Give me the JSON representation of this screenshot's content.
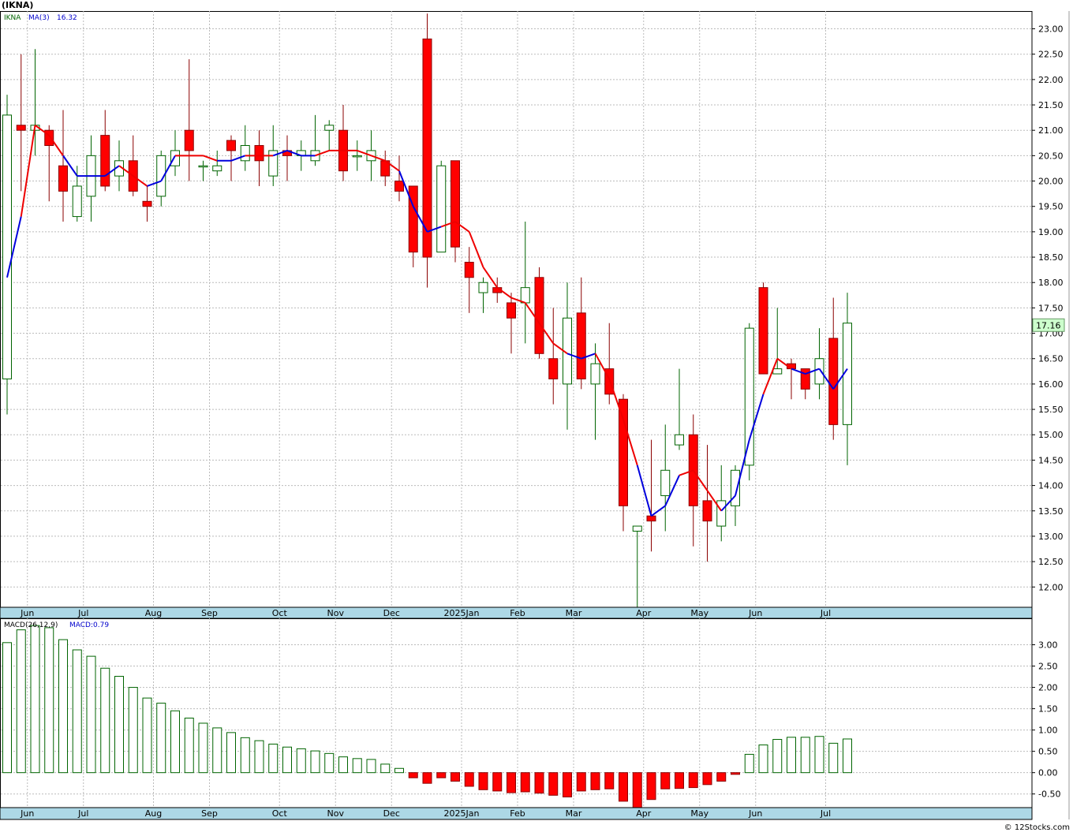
{
  "header": {
    "title": "(IKNA)"
  },
  "footer": {
    "credit": "© 12Stocks.com"
  },
  "colors": {
    "up_body": "#ffffff",
    "up_border": "#006400",
    "down_body": "#ff0000",
    "down_border": "#8b0000",
    "ma_up": "#0000dd",
    "ma_down": "#ee0000",
    "grid": "#bbbbbb",
    "axis_bar": "#add8e6",
    "macd_pos": "#006400",
    "macd_neg": "#ff0000",
    "last_price_bg": "#ccffcc"
  },
  "chart_data": [
    {
      "type": "candlestick",
      "legend": {
        "symbol": "IKNA",
        "ma_label": "MA(3)",
        "ma_value": "16.32"
      },
      "last_price_label": "17.16",
      "ylim": [
        11.6,
        23.35
      ],
      "y_ticks": [
        "12.00",
        "12.50",
        "13.00",
        "13.50",
        "14.00",
        "14.50",
        "15.00",
        "15.50",
        "16.00",
        "16.50",
        "17.00",
        "17.50",
        "18.00",
        "18.50",
        "19.00",
        "19.50",
        "20.00",
        "20.50",
        "21.00",
        "21.50",
        "22.00",
        "22.50",
        "23.00"
      ],
      "x_labels": [
        {
          "label": "Jun",
          "week": 1
        },
        {
          "label": "Jul",
          "week": 5
        },
        {
          "label": "Aug",
          "week": 10
        },
        {
          "label": "Sep",
          "week": 14
        },
        {
          "label": "Oct",
          "week": 19
        },
        {
          "label": "Nov",
          "week": 23
        },
        {
          "label": "Dec",
          "week": 27
        },
        {
          "label": "2025Jan",
          "week": 32
        },
        {
          "label": "Feb",
          "week": 36
        },
        {
          "label": "Mar",
          "week": 40
        },
        {
          "label": "Apr",
          "week": 45
        },
        {
          "label": "May",
          "week": 49
        },
        {
          "label": "Jun",
          "week": 53
        },
        {
          "label": "Jul",
          "week": 58
        }
      ],
      "candles": [
        {
          "o": 16.1,
          "h": 21.7,
          "l": 15.4,
          "c": 21.3
        },
        {
          "o": 21.1,
          "h": 22.5,
          "l": 19.8,
          "c": 21.0
        },
        {
          "o": 21.0,
          "h": 22.6,
          "l": 20.5,
          "c": 21.1
        },
        {
          "o": 21.0,
          "h": 21.1,
          "l": 19.6,
          "c": 20.7
        },
        {
          "o": 20.3,
          "h": 21.4,
          "l": 19.2,
          "c": 19.8
        },
        {
          "o": 19.3,
          "h": 20.3,
          "l": 19.2,
          "c": 19.9
        },
        {
          "o": 19.7,
          "h": 20.9,
          "l": 19.2,
          "c": 20.5
        },
        {
          "o": 20.9,
          "h": 21.4,
          "l": 19.8,
          "c": 19.9
        },
        {
          "o": 20.1,
          "h": 20.8,
          "l": 19.8,
          "c": 20.4
        },
        {
          "o": 20.4,
          "h": 20.9,
          "l": 19.7,
          "c": 19.8
        },
        {
          "o": 19.6,
          "h": 19.9,
          "l": 19.2,
          "c": 19.5
        },
        {
          "o": 19.7,
          "h": 20.6,
          "l": 19.5,
          "c": 20.5
        },
        {
          "o": 20.3,
          "h": 21.0,
          "l": 20.1,
          "c": 20.6
        },
        {
          "o": 21.0,
          "h": 22.4,
          "l": 20.0,
          "c": 20.6
        },
        {
          "o": 20.3,
          "h": 20.4,
          "l": 20.0,
          "c": 20.3
        },
        {
          "o": 20.2,
          "h": 20.6,
          "l": 20.1,
          "c": 20.3
        },
        {
          "o": 20.8,
          "h": 20.9,
          "l": 20.0,
          "c": 20.6
        },
        {
          "o": 20.4,
          "h": 21.1,
          "l": 20.2,
          "c": 20.7
        },
        {
          "o": 20.7,
          "h": 21.0,
          "l": 19.9,
          "c": 20.4
        },
        {
          "o": 20.1,
          "h": 21.1,
          "l": 19.9,
          "c": 20.6
        },
        {
          "o": 20.6,
          "h": 20.9,
          "l": 20.0,
          "c": 20.5
        },
        {
          "o": 20.5,
          "h": 20.8,
          "l": 20.2,
          "c": 20.6
        },
        {
          "o": 20.4,
          "h": 21.3,
          "l": 20.3,
          "c": 20.6
        },
        {
          "o": 21.0,
          "h": 21.2,
          "l": 20.6,
          "c": 21.1
        },
        {
          "o": 21.0,
          "h": 21.5,
          "l": 20.0,
          "c": 20.2
        },
        {
          "o": 20.5,
          "h": 20.8,
          "l": 20.2,
          "c": 20.5
        },
        {
          "o": 20.4,
          "h": 21.0,
          "l": 20.0,
          "c": 20.6
        },
        {
          "o": 20.4,
          "h": 20.6,
          "l": 19.9,
          "c": 20.1
        },
        {
          "o": 20.0,
          "h": 20.5,
          "l": 19.6,
          "c": 19.8
        },
        {
          "o": 19.9,
          "h": 19.9,
          "l": 18.3,
          "c": 18.6
        },
        {
          "o": 22.8,
          "h": 23.3,
          "l": 17.9,
          "c": 18.5
        },
        {
          "o": 18.6,
          "h": 20.4,
          "l": 18.6,
          "c": 20.3
        },
        {
          "o": 20.4,
          "h": 20.4,
          "l": 18.4,
          "c": 18.7
        },
        {
          "o": 18.4,
          "h": 18.7,
          "l": 17.4,
          "c": 18.1
        },
        {
          "o": 17.8,
          "h": 18.1,
          "l": 17.4,
          "c": 18.0
        },
        {
          "o": 17.9,
          "h": 18.1,
          "l": 17.6,
          "c": 17.8
        },
        {
          "o": 17.6,
          "h": 17.8,
          "l": 16.6,
          "c": 17.3
        },
        {
          "o": 17.6,
          "h": 19.2,
          "l": 16.8,
          "c": 17.9
        },
        {
          "o": 18.1,
          "h": 18.3,
          "l": 16.5,
          "c": 16.6
        },
        {
          "o": 16.5,
          "h": 17.5,
          "l": 15.6,
          "c": 16.1
        },
        {
          "o": 16.0,
          "h": 18.0,
          "l": 15.1,
          "c": 17.3
        },
        {
          "o": 17.4,
          "h": 18.1,
          "l": 15.9,
          "c": 16.1
        },
        {
          "o": 16.0,
          "h": 16.8,
          "l": 14.9,
          "c": 16.4
        },
        {
          "o": 16.3,
          "h": 17.2,
          "l": 15.6,
          "c": 15.8
        },
        {
          "o": 15.7,
          "h": 15.8,
          "l": 13.1,
          "c": 13.6
        },
        {
          "o": 13.1,
          "h": 13.2,
          "l": 11.6,
          "c": 13.2
        },
        {
          "o": 13.4,
          "h": 14.9,
          "l": 12.7,
          "c": 13.3
        },
        {
          "o": 13.8,
          "h": 15.2,
          "l": 13.1,
          "c": 14.3
        },
        {
          "o": 14.8,
          "h": 16.3,
          "l": 14.7,
          "c": 15.0
        },
        {
          "o": 15.0,
          "h": 15.4,
          "l": 12.8,
          "c": 13.6
        },
        {
          "o": 13.7,
          "h": 14.8,
          "l": 12.5,
          "c": 13.3
        },
        {
          "o": 13.2,
          "h": 14.4,
          "l": 12.9,
          "c": 13.7
        },
        {
          "o": 13.6,
          "h": 14.4,
          "l": 13.2,
          "c": 14.3
        },
        {
          "o": 14.4,
          "h": 17.2,
          "l": 14.1,
          "c": 17.1
        },
        {
          "o": 17.9,
          "h": 18.0,
          "l": 16.2,
          "c": 16.2
        },
        {
          "o": 16.2,
          "h": 17.5,
          "l": 16.2,
          "c": 16.3
        },
        {
          "o": 16.4,
          "h": 16.5,
          "l": 15.7,
          "c": 16.3
        },
        {
          "o": 16.3,
          "h": 16.3,
          "l": 15.7,
          "c": 15.9
        },
        {
          "o": 16.0,
          "h": 17.1,
          "l": 15.7,
          "c": 16.5
        },
        {
          "o": 16.9,
          "h": 17.7,
          "l": 14.9,
          "c": 15.2
        },
        {
          "o": 15.2,
          "h": 17.8,
          "l": 14.4,
          "c": 17.2
        }
      ],
      "ma3": [
        18.1,
        19.3,
        21.1,
        20.9,
        20.5,
        20.1,
        20.1,
        20.1,
        20.3,
        20.1,
        19.9,
        20.0,
        20.5,
        20.5,
        20.5,
        20.4,
        20.4,
        20.5,
        20.5,
        20.5,
        20.6,
        20.5,
        20.5,
        20.6,
        20.6,
        20.6,
        20.5,
        20.4,
        20.2,
        19.5,
        19.0,
        19.1,
        19.2,
        19.0,
        18.3,
        17.9,
        17.7,
        17.6,
        17.2,
        16.8,
        16.6,
        16.5,
        16.6,
        16.1,
        15.3,
        14.4,
        13.4,
        13.6,
        14.2,
        14.3,
        13.9,
        13.5,
        13.8,
        14.9,
        15.8,
        16.5,
        16.3,
        16.2,
        16.3,
        15.9,
        16.3
      ],
      "ma_color": [
        "u",
        "u",
        "d",
        "d",
        "d",
        "u",
        "u",
        "u",
        "u",
        "d",
        "d",
        "u",
        "u",
        "d",
        "d",
        "d",
        "u",
        "u",
        "d",
        "d",
        "u",
        "u",
        "u",
        "d",
        "d",
        "d",
        "d",
        "d",
        "d",
        "u",
        "u",
        "u",
        "d",
        "d",
        "d",
        "d",
        "d",
        "d",
        "d",
        "d",
        "d",
        "u",
        "u",
        "d",
        "d",
        "d",
        "u",
        "u",
        "u",
        "d",
        "d",
        "d",
        "u",
        "u",
        "u",
        "d",
        "d",
        "u",
        "u",
        "u",
        "u"
      ]
    },
    {
      "type": "bar",
      "legend": {
        "label": "MACD(26,12,9)",
        "value": "MACD:0.79"
      },
      "ylim": [
        -0.82,
        3.62
      ],
      "y_ticks": [
        "-0.50",
        "0.00",
        "0.50",
        "1.00",
        "1.50",
        "2.00",
        "2.50",
        "3.00"
      ],
      "values": [
        3.05,
        3.35,
        3.45,
        3.4,
        3.12,
        2.88,
        2.73,
        2.45,
        2.26,
        2.0,
        1.75,
        1.63,
        1.45,
        1.28,
        1.16,
        1.05,
        0.94,
        0.82,
        0.75,
        0.67,
        0.6,
        0.56,
        0.51,
        0.45,
        0.37,
        0.33,
        0.31,
        0.2,
        0.1,
        -0.12,
        -0.25,
        -0.12,
        -0.2,
        -0.32,
        -0.4,
        -0.43,
        -0.47,
        -0.45,
        -0.48,
        -0.53,
        -0.57,
        -0.43,
        -0.4,
        -0.38,
        -0.67,
        -0.82,
        -0.63,
        -0.38,
        -0.37,
        -0.35,
        -0.28,
        -0.2,
        -0.04,
        0.43,
        0.65,
        0.78,
        0.83,
        0.83,
        0.85,
        0.69,
        0.79
      ]
    }
  ]
}
